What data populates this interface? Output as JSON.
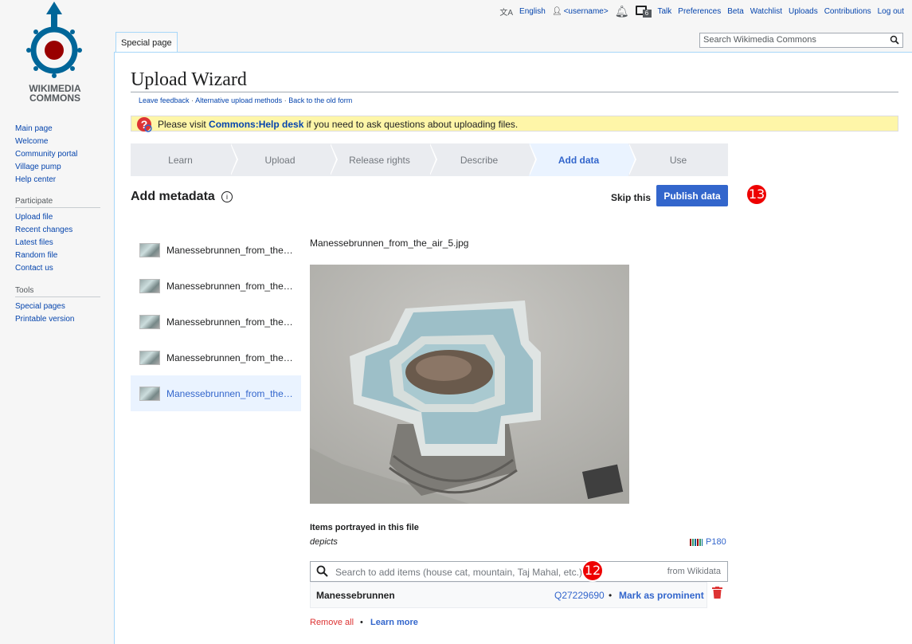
{
  "logo": {
    "line1": "WIKIMEDIA",
    "line2": "COMMONS"
  },
  "sidebar": {
    "nav": [
      "Main page",
      "Welcome",
      "Community portal",
      "Village pump",
      "Help center"
    ],
    "participate": {
      "heading": "Participate",
      "items": [
        "Upload file",
        "Recent changes",
        "Latest files",
        "Random file",
        "Contact us"
      ]
    },
    "tools": {
      "heading": "Tools",
      "items": [
        "Special pages",
        "Printable version"
      ]
    }
  },
  "personal": {
    "language": "English",
    "username": "<username>",
    "notif_count": "6",
    "links": [
      "Talk",
      "Preferences",
      "Beta",
      "Watchlist",
      "Uploads",
      "Contributions",
      "Log out"
    ]
  },
  "tabs": {
    "special": "Special page"
  },
  "search": {
    "placeholder": "Search Wikimedia Commons"
  },
  "page": {
    "title": "Upload Wizard",
    "subnav": [
      "Leave feedback",
      "Alternative upload methods",
      "Back to the old form"
    ],
    "notice": {
      "prefix": "Please visit ",
      "link": "Commons:Help desk",
      "suffix": " if you need to ask questions about uploading files."
    }
  },
  "steps": [
    {
      "label": "Learn",
      "active": false
    },
    {
      "label": "Upload",
      "active": false
    },
    {
      "label": "Release rights",
      "active": false
    },
    {
      "label": "Describe",
      "active": false
    },
    {
      "label": "Add data",
      "active": true
    },
    {
      "label": "Use",
      "active": false
    }
  ],
  "metadata": {
    "heading": "Add metadata",
    "info_icon": "i",
    "skip": "Skip this",
    "publish": "Publish data",
    "badge_publish": "13"
  },
  "files": [
    "Manessebrunnen_from_the…",
    "Manessebrunnen_from_the…",
    "Manessebrunnen_from_the…",
    "Manessebrunnen_from_the…",
    "Manessebrunnen_from_the…"
  ],
  "selected_file_index": 4,
  "detail": {
    "filename": "Manessebrunnen_from_the_air_5.jpg",
    "depicts_label": "Items portrayed in this file",
    "depicts_sub": "depicts",
    "property": "P180",
    "search_placeholder": "Search to add items (house cat, mountain, Taj Mahal, etc.)",
    "search_source": "from Wikidata",
    "badge_search": "12",
    "item": {
      "name": "Manessebrunnen",
      "qid": "Q27229690",
      "separator": "•",
      "prominent": "Mark as prominent"
    },
    "remove_all": "Remove all",
    "bullet": "•",
    "learn_more": "Learn more"
  },
  "icons": [
    "translate-icon",
    "user-icon",
    "bell-icon",
    "notices-icon",
    "search-icon",
    "help-icon",
    "info-icon",
    "trash-icon",
    "wikidata-barcode-icon"
  ],
  "colors": {
    "accent": "#3366cc",
    "notice_bg": "#fef6a8",
    "badge": "#ee0000",
    "destructive": "#dd3333"
  }
}
